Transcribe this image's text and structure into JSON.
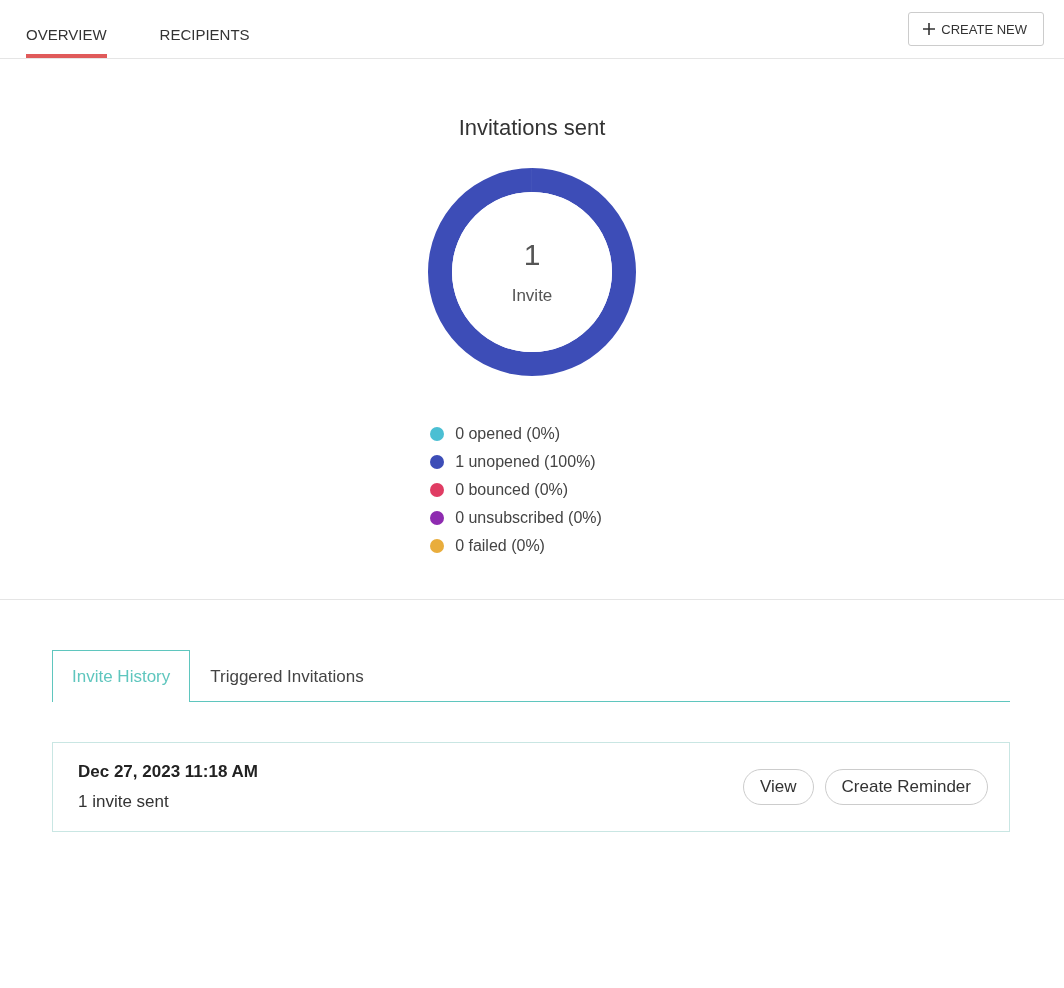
{
  "tabs": [
    {
      "label": "OVERVIEW",
      "selected": true
    },
    {
      "label": "RECIPIENTS",
      "selected": false
    }
  ],
  "create_button": {
    "label": "CREATE NEW"
  },
  "summary": {
    "center_value": "1",
    "center_label": "Invite",
    "chart_data": {
      "type": "donut",
      "title": "Invitations sent",
      "values": [
        0,
        1,
        0,
        0,
        0
      ]
    },
    "legend": [
      {
        "text": "0 opened (0%)",
        "color": "#4bbfd3"
      },
      {
        "text": "1 unopened (100%)",
        "color": "#3d4db7"
      },
      {
        "text": "0 bounced (0%)",
        "color": "#e03c63"
      },
      {
        "text": "0 unsubscribed (0%)",
        "color": "#8e2bb0"
      },
      {
        "text": "0 failed (0%)",
        "color": "#e9ad3c"
      }
    ]
  },
  "history_tabs": [
    {
      "label": "Invite History",
      "selected": true
    },
    {
      "label": "Triggered Invitations",
      "selected": false
    }
  ],
  "history": [
    {
      "date": "Dec 27, 2023 11:18 AM",
      "detail": "1 invite sent",
      "actions": [
        "View",
        "Create Reminder"
      ]
    }
  ]
}
